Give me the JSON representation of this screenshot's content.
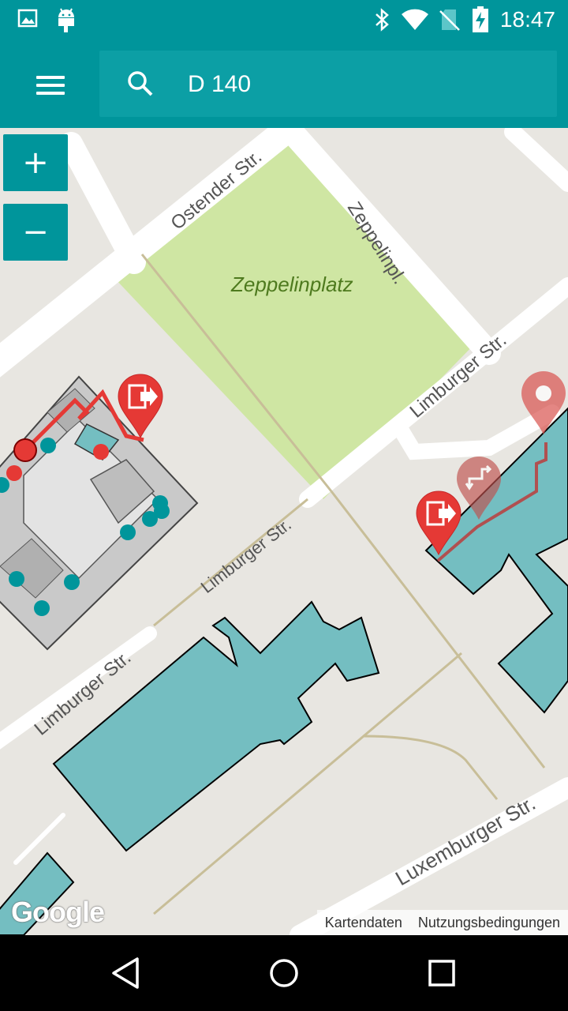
{
  "status_bar": {
    "time": "18:47",
    "left_icons": [
      "image-icon",
      "android-icon"
    ],
    "right_icons": [
      "bluetooth-icon",
      "wifi-icon",
      "no-sim-icon",
      "battery-charging-icon"
    ]
  },
  "app_bar": {
    "search_value": "D 140",
    "menu_icon": "hamburger-menu-icon",
    "search_icon": "search-icon"
  },
  "map": {
    "zoom_in_label": "+",
    "zoom_out_label": "−",
    "park_label": "Zeppelinplatz",
    "street_labels": {
      "ostender": "Ostender Str.",
      "zeppelinpl": "Zeppelinpl.",
      "limburger_ne": "Limburger Str.",
      "limburger_mid": "Limburger Str.",
      "limburger_sw": "Limburger Str.",
      "luxemburger": "Luxemburger Str."
    },
    "google_logo": "Google",
    "attribution": {
      "map_data": "Kartendaten",
      "terms": "Nutzungsbedingungen"
    },
    "colors": {
      "building": "#74bec1",
      "park": "#cfe6a3",
      "route": "#e53935",
      "marker": "#e53935",
      "accent": "#00959b"
    },
    "markers": [
      "exit-marker-icon",
      "exit-marker-icon",
      "stairs-marker-icon",
      "location-marker-icon"
    ]
  },
  "nav_bar": {
    "back_icon": "back-triangle-icon",
    "home_icon": "home-circle-icon",
    "recents_icon": "recents-square-icon"
  }
}
